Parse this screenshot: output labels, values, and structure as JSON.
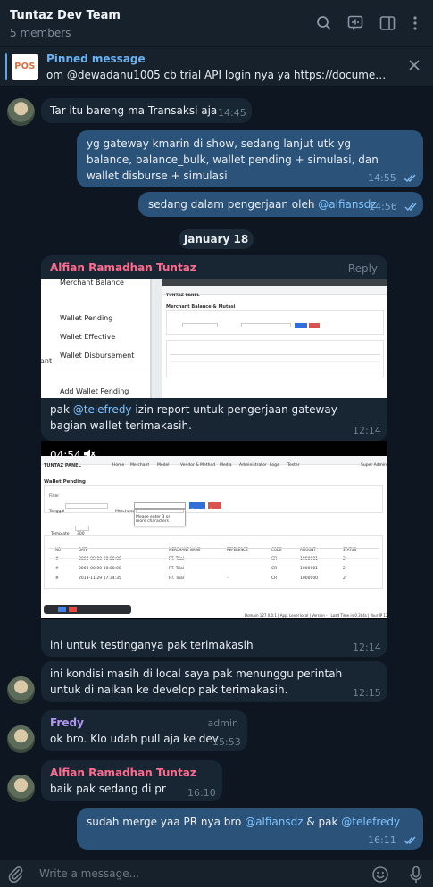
{
  "header": {
    "title": "Tuntaz Dev Team",
    "members": "5 members",
    "icons": [
      "search-icon",
      "live-stream-icon",
      "sidebar-toggle-icon",
      "more-vertical-icon"
    ]
  },
  "pinned": {
    "label": "Pinned message",
    "text": "om @dewadanu1005 cb trial API login nya ya  https://documenter.g...",
    "thumb": "POS"
  },
  "messages": {
    "m1": {
      "text": "Tar itu bareng ma Transaksi aja",
      "time": "14:45"
    },
    "m2": {
      "text": "yg gateway kmarin di show, sedang lanjut utk yg balance, balance_bulk, wallet pending + simulasi, dan wallet disburse + simulasi",
      "time": "14:55"
    },
    "m3": {
      "text_pre": "sedang dalam pengerjaan oleh ",
      "mention": "@alfiansdz",
      "time": "14:56"
    },
    "date": "January 18",
    "m4": {
      "sender": "Alfian Ramadhan Tuntaz",
      "reply": "Reply",
      "text_pre": "pak ",
      "mention": "@telefredy",
      "text_post": " izin report untuk pengerjaan gateway bagian wallet terimakasih.",
      "time": "12:14",
      "menu": [
        "Merchant Balance",
        "Wallet Pending",
        "Wallet Effective",
        "Wallet Disbursement",
        "Add Wallet Pending"
      ],
      "menu_left": "ant",
      "panel_title": "Merchant Balance & Mutasi"
    },
    "m5": {
      "duration": "04:54",
      "text": "ini untuk testinganya pak terimakasih",
      "time": "12:14",
      "video": {
        "brand": "TUNTAZ PANEL",
        "nav": [
          "Home",
          "Merchant",
          "Model",
          "Vendor & Method",
          "Media",
          "Administrator",
          "Logs",
          "Tester"
        ],
        "user": "Super Admin",
        "page_title": "Wallet Pending",
        "filter": "Filter",
        "tanggal": "Tanggal",
        "merchant": "Merchant",
        "select_placeholder": "Cari Merchant...",
        "hint": "Please enter 3 or more characters",
        "submit": "Submit",
        "reset": "Reset",
        "template": "Template",
        "template_val": "300",
        "columns": [
          "NO",
          "DATE",
          "MERCHANT NAME",
          "REFERENCE",
          "CODE",
          "AMOUNT",
          "STATUS"
        ],
        "rows": [
          [
            "#",
            "0000-00-00 00:00:00",
            "PT. Trial",
            "-",
            "CR",
            "1000001",
            "2"
          ],
          [
            "#",
            "0000-00-00 00:00:00",
            "PT. Trial",
            "-",
            "CR",
            "1000001",
            "2"
          ],
          [
            "#",
            "2013-11-29 17:34:35",
            "PT. Trial",
            "-",
            "CR",
            "1000000",
            "2"
          ]
        ],
        "footer": "Domain 127.0.0.1 | App. Level local | Version - | Load Time in 0.304s | Your IP 127.0.0.1"
      }
    },
    "m6": {
      "text": "ini kondisi masih di local saya pak menunggu perintah untuk di naikan ke develop pak terimakasih.",
      "time": "12:15"
    },
    "m7": {
      "sender": "Fredy",
      "badge": "admin",
      "text": "ok bro. Klo udah pull aja ke dev",
      "time": "15:53"
    },
    "m8": {
      "sender": "Alfian Ramadhan Tuntaz",
      "text": "baik pak sedang di pr",
      "time": "16:10"
    },
    "m9": {
      "text_pre": "sudah merge yaa PR nya bro ",
      "mention1": "@alfiansdz",
      "text_mid": " & pak ",
      "mention2": "@telefredy",
      "time": "16:11"
    }
  },
  "composer": {
    "placeholder": "Write a message..."
  },
  "colors": {
    "accent": "#6ab3f3",
    "outgoing": "#2b5278",
    "incoming": "#182533",
    "sender_alfian": "#ff6a8d",
    "sender_fredy": "#b198f0"
  }
}
